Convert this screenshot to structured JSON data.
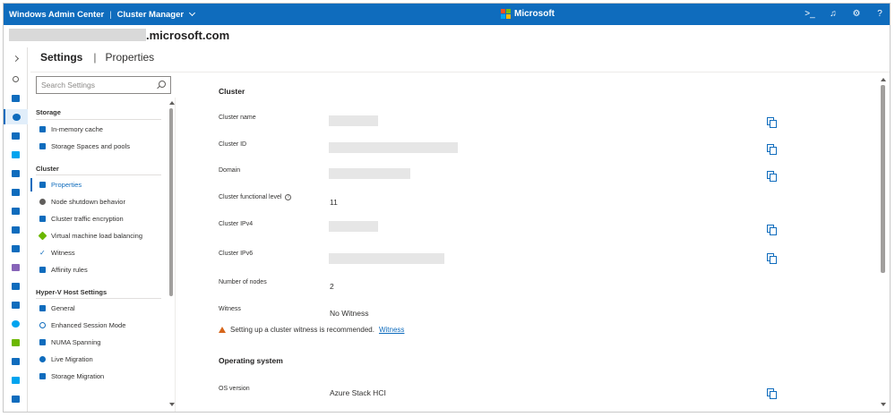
{
  "topbar": {
    "app_name": "Windows Admin Center",
    "separator": "|",
    "tool_name": "Cluster Manager",
    "brand": "Microsoft",
    "brand_colors": [
      "#f25022",
      "#7fba00",
      "#00a4ef",
      "#ffb900"
    ],
    "icons": [
      "terminal-icon",
      "bell-icon",
      "gear-icon",
      "help-icon"
    ],
    "icon_glyphs": [
      ">_",
      "♫",
      "⚙",
      "?"
    ]
  },
  "host": {
    "name_suffix": ".microsoft.com"
  },
  "tabs": {
    "settings": "Settings",
    "separator": "|",
    "properties": "Properties"
  },
  "search": {
    "placeholder": "Search Settings"
  },
  "nav": {
    "sections": [
      {
        "title": "Storage",
        "items": [
          {
            "label": "In-memory cache",
            "icon": "memory-icon",
            "color": "#0f6cbd"
          },
          {
            "label": "Storage Spaces and pools",
            "icon": "storage-pool-icon",
            "color": "#0f6cbd"
          }
        ]
      },
      {
        "title": "Cluster",
        "items": [
          {
            "label": "Properties",
            "icon": "properties-icon",
            "color": "#0f6cbd",
            "active": true
          },
          {
            "label": "Node shutdown behavior",
            "icon": "shutdown-icon",
            "color": "#605e5c"
          },
          {
            "label": "Cluster traffic encryption",
            "icon": "encryption-icon",
            "color": "#0f6cbd"
          },
          {
            "label": "Virtual machine load balancing",
            "icon": "load-balancing-icon",
            "color": "#6bb700"
          },
          {
            "label": "Witness",
            "icon": "checkmark-icon",
            "color": "#0f6cbd"
          },
          {
            "label": "Affinity rules",
            "icon": "affinity-icon",
            "color": "#0f6cbd"
          }
        ]
      },
      {
        "title": "Hyper-V Host Settings",
        "items": [
          {
            "label": "General",
            "icon": "general-icon",
            "color": "#0f6cbd"
          },
          {
            "label": "Enhanced Session Mode",
            "icon": "session-icon",
            "color": "#0f6cbd"
          },
          {
            "label": "NUMA Spanning",
            "icon": "numa-icon",
            "color": "#0f6cbd"
          },
          {
            "label": "Live Migration",
            "icon": "live-migration-icon",
            "color": "#0f6cbd"
          },
          {
            "label": "Storage Migration",
            "icon": "storage-migration-icon",
            "color": "#0f6cbd"
          }
        ]
      }
    ]
  },
  "cluster": {
    "title": "Cluster",
    "fields": [
      {
        "label": "Cluster name",
        "value": "",
        "copy": true
      },
      {
        "label": "Cluster ID",
        "value": "",
        "copy": true
      },
      {
        "label": "Domain",
        "value": "",
        "copy": true
      },
      {
        "label": "Cluster functional level",
        "value": "11",
        "copy": false,
        "info": true
      },
      {
        "label": "Cluster IPv4",
        "value": "",
        "copy": true
      },
      {
        "label": "Cluster IPv6",
        "value": "",
        "copy": true
      },
      {
        "label": "Number of nodes",
        "value": "2",
        "copy": false
      },
      {
        "label": "Witness",
        "value": "No Witness",
        "copy": false
      }
    ],
    "warning_text": "Setting up a cluster witness is recommended.",
    "warning_link": "Witness"
  },
  "os": {
    "title": "Operating system",
    "version_label": "OS version",
    "version_value": "Azure Stack HCI"
  },
  "accent_color": "#0f6cbd"
}
